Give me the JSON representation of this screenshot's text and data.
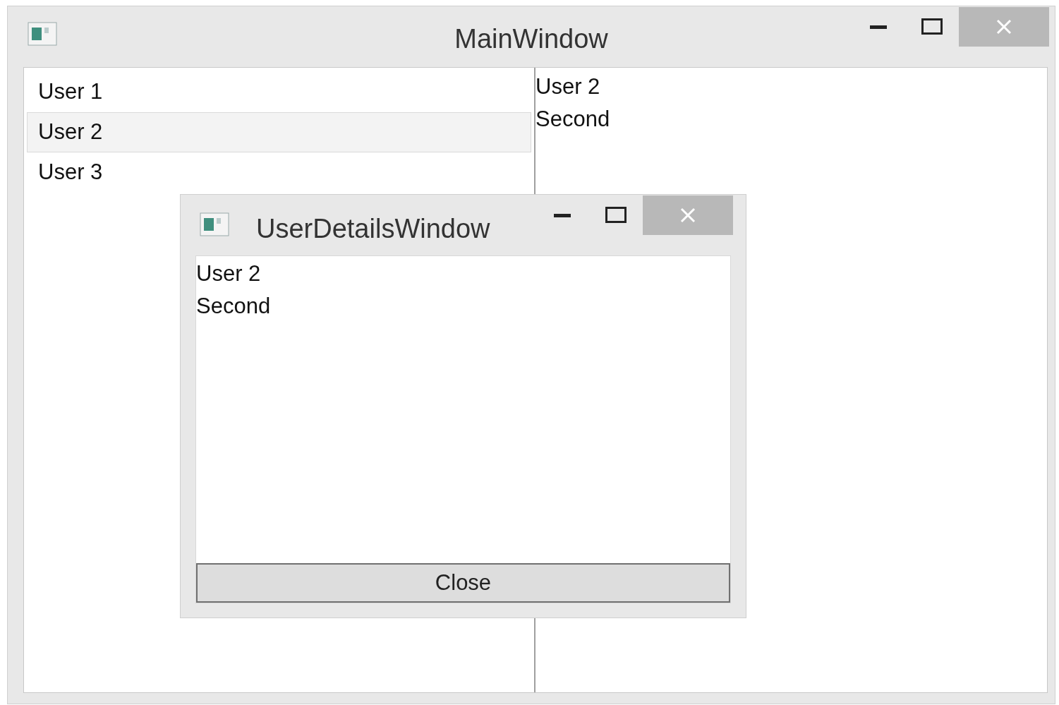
{
  "main_window": {
    "title": "MainWindow"
  },
  "user_list": [
    {
      "name": "User 1",
      "selected": false
    },
    {
      "name": "User 2",
      "selected": true
    },
    {
      "name": "User 3",
      "selected": false
    }
  ],
  "details": {
    "name": "User 2",
    "description": "Second"
  },
  "dialog": {
    "title": "UserDetailsWindow",
    "name": "User 2",
    "description": "Second",
    "close_button": "Close"
  }
}
